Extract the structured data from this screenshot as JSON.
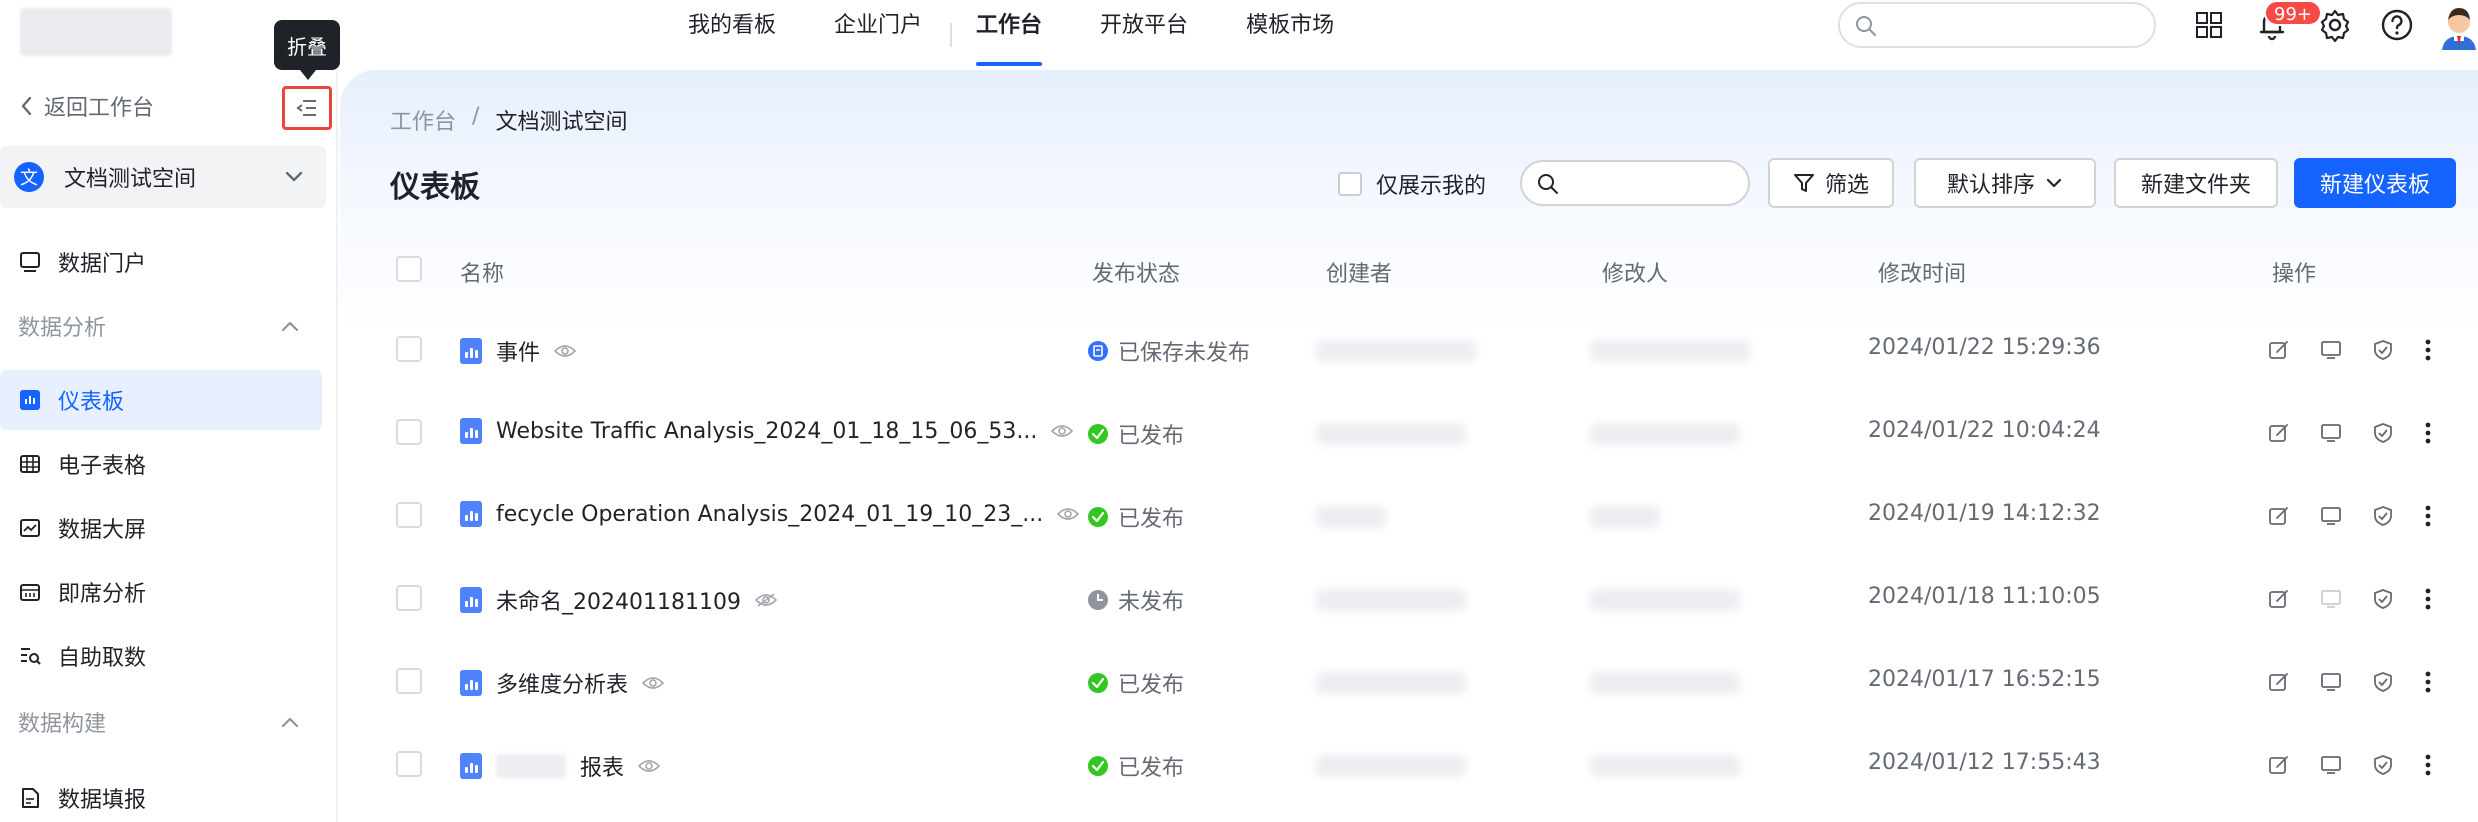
{
  "topnav": {
    "items": [
      "我的看板",
      "企业门户",
      "工作台",
      "开放平台",
      "模板市场"
    ],
    "active_index": 2,
    "notification_badge": "99+"
  },
  "sidebar": {
    "back_label": "返回工作台",
    "collapse_tooltip": "折叠",
    "space": {
      "icon_char": "文",
      "name": "文档测试空间"
    },
    "portal_label": "数据门户",
    "group_analysis": "数据分析",
    "analysis_items": [
      "仪表板",
      "电子表格",
      "数据大屏",
      "即席分析",
      "自助取数"
    ],
    "active_item": "仪表板",
    "group_build": "数据构建",
    "build_items": [
      "数据填报"
    ]
  },
  "breadcrumb": {
    "root": "工作台",
    "separator": "/",
    "current": "文档测试空间"
  },
  "page_title": "仪表板",
  "toolbar": {
    "only_mine_label": "仅展示我的",
    "filter_label": "筛选",
    "sort_label": "默认排序",
    "new_folder_label": "新建文件夹",
    "new_dashboard_label": "新建仪表板"
  },
  "table": {
    "headers": [
      "名称",
      "发布状态",
      "创建者",
      "修改人",
      "修改时间",
      "操作"
    ],
    "rows": [
      {
        "name": "事件",
        "status": "已保存未发布",
        "status_type": "saved",
        "modified": "2024/01/22 15:29:36",
        "present_enabled": true
      },
      {
        "name": "Website Traffic Analysis_2024_01_18_15_06_53...",
        "status": "已发布",
        "status_type": "published",
        "modified": "2024/01/22 10:04:24",
        "present_enabled": true
      },
      {
        "name": "fecycle Operation Analysis_2024_01_19_10_23_...",
        "status": "已发布",
        "status_type": "published",
        "modified": "2024/01/19 14:12:32",
        "present_enabled": true
      },
      {
        "name": "未命名_202401181109",
        "status": "未发布",
        "status_type": "unpublished",
        "modified": "2024/01/18 11:10:05",
        "present_enabled": false
      },
      {
        "name": "多维度分析表",
        "status": "已发布",
        "status_type": "published",
        "modified": "2024/01/17 16:52:15",
        "present_enabled": true
      },
      {
        "name": "报表",
        "status": "已发布",
        "status_type": "published",
        "modified": "2024/01/12 17:55:43",
        "present_enabled": true
      }
    ]
  },
  "colors": {
    "accent": "#1664ff",
    "published": "#34c724",
    "saved": "#3370ff",
    "unpublished": "#8f959e",
    "highlight_border": "#e5483b"
  }
}
